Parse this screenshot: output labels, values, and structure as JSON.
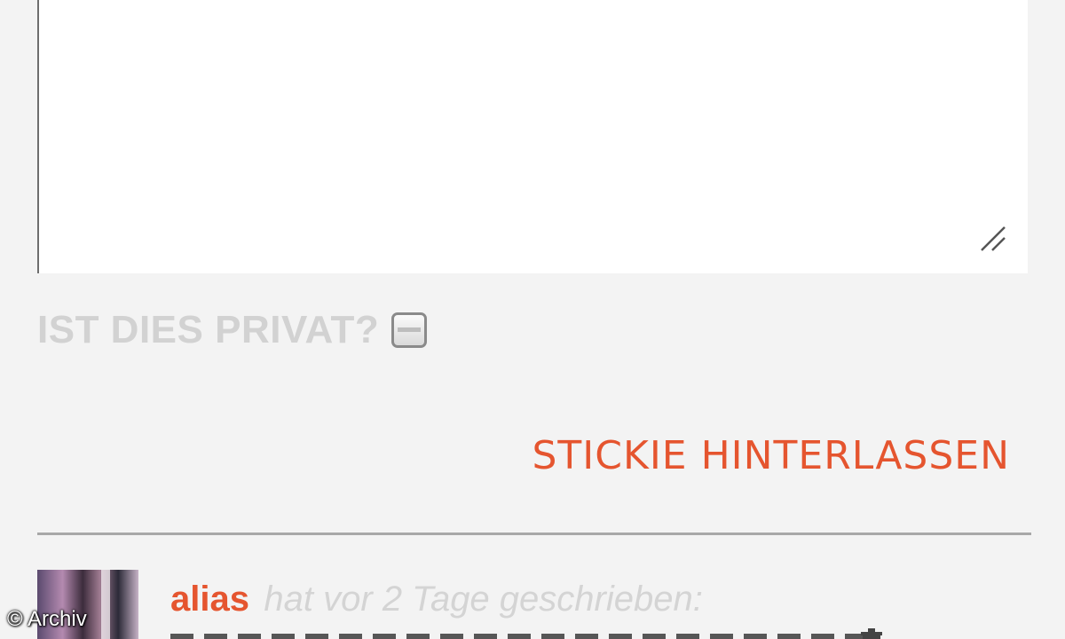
{
  "form": {
    "textarea_value": "",
    "private_label": "IST DIES PRIVAT?",
    "private_checked": false,
    "submit_label": "STICKIE HINTERLASSEN"
  },
  "comments": [
    {
      "author": "alias",
      "meta": "hat vor 2 Tage geschrieben:",
      "body_icon": "trash-icon"
    }
  ],
  "watermark": "© Archiv",
  "colors": {
    "accent": "#e5552f",
    "label_muted": "#d2d2d2",
    "background": "#f3f3f3"
  }
}
